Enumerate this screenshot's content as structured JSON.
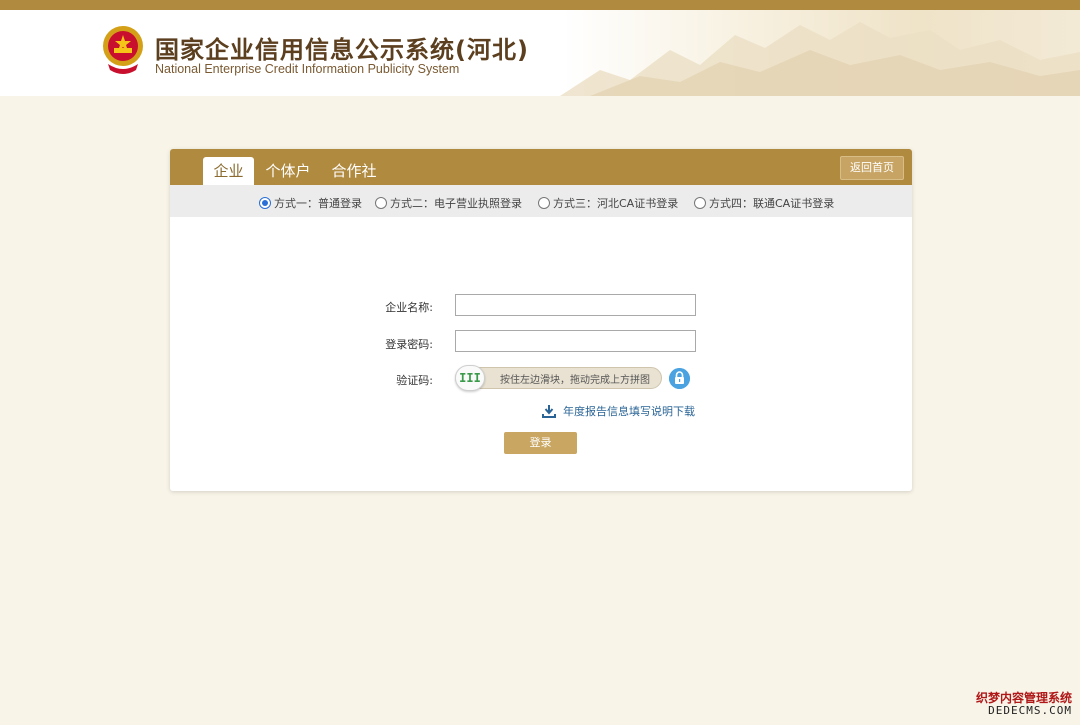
{
  "header": {
    "title": "国家企业信用信息公示系统(河北)",
    "subtitle": "National Enterprise Credit Information Publicity System"
  },
  "tabs": [
    {
      "label": "企业",
      "active": true
    },
    {
      "label": "个体户",
      "active": false
    },
    {
      "label": "合作社",
      "active": false
    }
  ],
  "back_home_label": "返回首页",
  "login_methods": [
    {
      "label": "方式一：普通登录",
      "checked": true
    },
    {
      "label": "方式二：电子营业执照登录",
      "checked": false
    },
    {
      "label": "方式三：河北CA证书登录",
      "checked": false
    },
    {
      "label": "方式四：联通CA证书登录",
      "checked": false
    }
  ],
  "form": {
    "company_name_label": "企业名称:",
    "company_name_value": "",
    "password_label": "登录密码:",
    "password_value": "",
    "captcha_label": "验证码:",
    "slider_hint": "按住左边滑块，拖动完成上方拼图",
    "slider_handle_glyph": "III",
    "download_link": "年度报告信息填写说明下载",
    "login_button": "登录"
  },
  "watermark": {
    "line1": "织梦内容管理系统",
    "line2": "DEDECMS.COM"
  },
  "colors": {
    "brand_gold": "#b08a3e",
    "background": "#f8f4e8",
    "radio_blue": "#2a6fd6",
    "link_blue": "#2a6496",
    "lock_blue": "#4aa3e0"
  }
}
